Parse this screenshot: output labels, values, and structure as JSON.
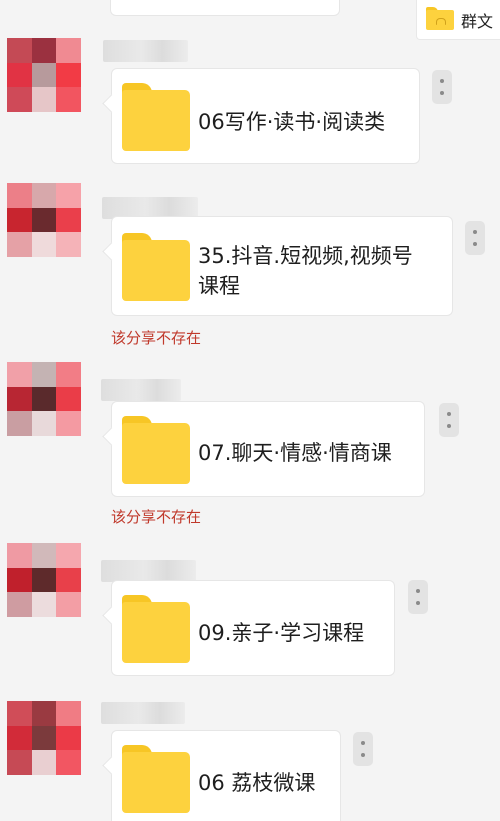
{
  "shared_chip": {
    "icon": "group-folder-icon",
    "label": "群文"
  },
  "messages": [
    {
      "folder_name": "06写作·读书·阅读类",
      "error": ""
    },
    {
      "folder_name": "35.抖音.短视频,视频号\n课程",
      "error": "该分享不存在"
    },
    {
      "folder_name": "07.聊天·情感·情商课",
      "error": "该分享不存在"
    },
    {
      "folder_name": "09.亲子·学习课程",
      "error": ""
    },
    {
      "folder_name": "06 荔枝微课",
      "error": ""
    }
  ],
  "colors": {
    "folder": "#fdd23e",
    "folder_tab": "#f7c625",
    "error_text": "#c0392b",
    "background": "#f4f4f4",
    "bubble": "#ffffff"
  },
  "icons": {
    "folder": "folder-icon",
    "more": "more-vertical-icon",
    "avatar": "avatar"
  }
}
